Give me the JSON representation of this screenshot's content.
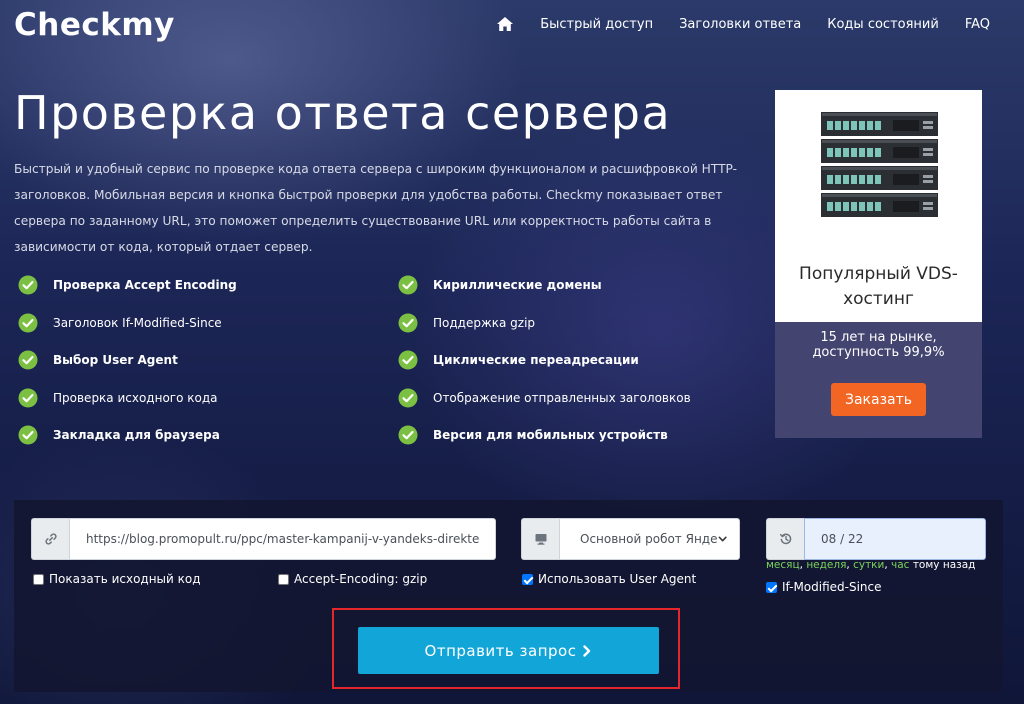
{
  "header": {
    "logo": "Checkmy",
    "nav": [
      {
        "label": "Быстрый доступ"
      },
      {
        "label": "Заголовки ответа"
      },
      {
        "label": "Коды состояний"
      },
      {
        "label": "FAQ"
      }
    ],
    "home_icon": "home-icon"
  },
  "hero": {
    "title": "Проверка ответа сервера",
    "description": "Быстрый и удобный сервис по проверке кода ответа сервера с широким функционалом и расшифровкой HTTP-заголовков. Мобильная версия и кнопка быстрой проверки для удобства работы. Checkmy показывает ответ сервера по заданному URL, это поможет определить существование URL или корректность работы сайта в зависимости от кода, который отдает сервер."
  },
  "features": [
    {
      "label": "Проверка Accept Encoding",
      "bold": true
    },
    {
      "label": "Заголовок If-Modified-Since",
      "bold": false
    },
    {
      "label": "Выбор User Agent",
      "bold": true
    },
    {
      "label": "Проверка исходного кода",
      "bold": false
    },
    {
      "label": "Закладка для браузера",
      "bold": true
    },
    {
      "label": "Кириллические домены",
      "bold": true
    },
    {
      "label": "Поддержка gzip",
      "bold": false
    },
    {
      "label": "Циклические переадресации",
      "bold": true
    },
    {
      "label": "Отображение отправленных заголовков",
      "bold": false
    },
    {
      "label": "Версия для мобильных устройств",
      "bold": true
    }
  ],
  "ad": {
    "title_line1": "Популярный VDS-",
    "title_line2": "хостинг",
    "sub_line1": "15 лет на рынке,",
    "sub_line2": "доступность 99,9%",
    "button": "Заказать"
  },
  "form": {
    "url_value": "https://blog.promopult.ru/ppc/master-kampanij-v-yandeks-direkte",
    "agent_selected": "Основной робот Яндекса",
    "date_value": "08 / 22",
    "checkbox_source": "Показать исходный код",
    "checkbox_gzip": "Accept-Encoding: gzip",
    "checkbox_agent": "Использовать User Agent",
    "checkbox_ims": "If-Modified-Since",
    "period": {
      "month": "месяц",
      "week": "неделя",
      "day": "сутки",
      "hour": "час",
      "sep": ",",
      "suffix": "тому назад"
    },
    "send_button": "Отправить запрос"
  },
  "colors": {
    "accent_orange": "#f26522",
    "send_blue": "#12a5d8",
    "check_green": "#7bc043",
    "highlight_red": "#e5262b",
    "ad_panel": "#434470"
  }
}
